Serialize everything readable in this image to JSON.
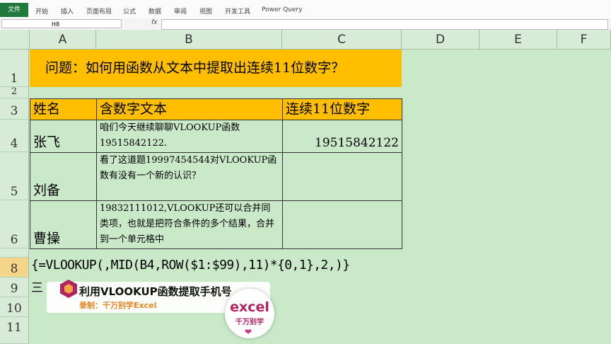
{
  "ribbon": {
    "tabs": [
      "文件",
      "开始",
      "插入",
      "页面布局",
      "公式",
      "数据",
      "审阅",
      "视图",
      "开发工具",
      "Power Query"
    ]
  },
  "formula_bar": {
    "name_box": "H8",
    "fx": "fx",
    "content": ""
  },
  "columns": [
    "A",
    "B",
    "C",
    "D",
    "E",
    "F"
  ],
  "rows": [
    "1",
    "2",
    "3",
    "4",
    "5",
    "6",
    "8",
    "9",
    "10",
    "11"
  ],
  "sheet": {
    "title": "问题：如何用函数从文本中提取出连续11位数字？",
    "headers": [
      "姓名",
      "含数字文本",
      "连续11位数字"
    ],
    "data": [
      {
        "name": "张飞",
        "text": "咱们今天继续聊聊VLOOKUP函数19515842122.",
        "result": "19515842122"
      },
      {
        "name": "刘备",
        "text": "看了这道题19997454544对VLOOKUP函数有没有一个新的认识？",
        "result": ""
      },
      {
        "name": "曹操",
        "text": "19832111012,VLOOKUP还可以合并同类项，也就是把符合条件的多个结果，合并到一个单元格中",
        "result": ""
      }
    ],
    "formula": "{=VLOOKUP(,MID(B4,ROW($1:$99),11)*{0,1},2,)}",
    "row9_text": "三"
  },
  "overlay": {
    "title": "利用VLOOKUP函数提取手机号",
    "subtitle": "录制：千万别学Excel"
  },
  "badge": {
    "logo": "excel",
    "sub": "千万别学"
  },
  "colors": {
    "sheet_bg": "#c9e9c9",
    "highlight": "#ffbe00",
    "brand": "#b2245e"
  }
}
